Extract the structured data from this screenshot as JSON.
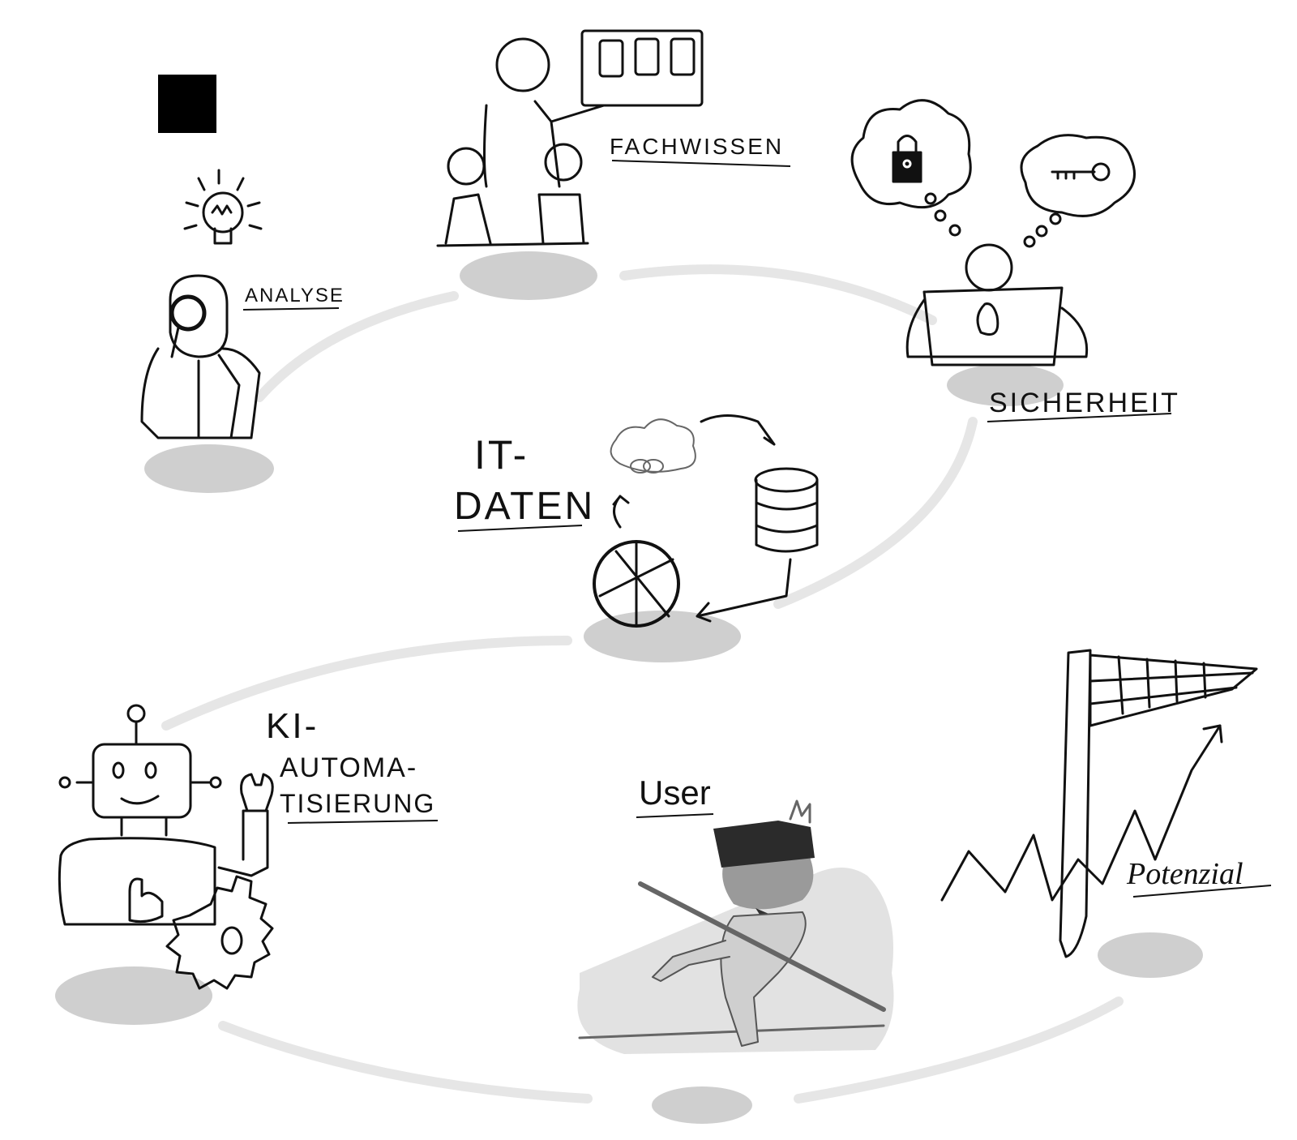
{
  "labels": {
    "analyse": "ANALYSE",
    "fachwissen": "FACHWISSEN",
    "sicherheit": "SICHERHEIT",
    "it_daten_line1": "IT-",
    "it_daten_line2": "DATEN",
    "ki_line1": "KI-",
    "ki_line2": "AUTOMA-",
    "ki_line3": "TISIERUNG",
    "user": "User",
    "potenzial": "Potenzial"
  },
  "colors": {
    "ink": "#111111",
    "path": "#e6e6e6",
    "shadow": "#cfcfcf",
    "fill_dark": "#2b2b2b",
    "fill_mid": "#9a9a9a"
  },
  "icons": {
    "analyse": "magnifier-person-lightbulb-icon",
    "fachwissen": "presenter-with-students-icon",
    "sicherheit": "person-laptop-lock-key-icon",
    "it_daten": "cloud-database-chart-cycle-icon",
    "ki": "robot-gear-wrench-icon",
    "user": "vr-tightrope-walker-icon",
    "potenzial": "growth-arrow-net-icon"
  }
}
